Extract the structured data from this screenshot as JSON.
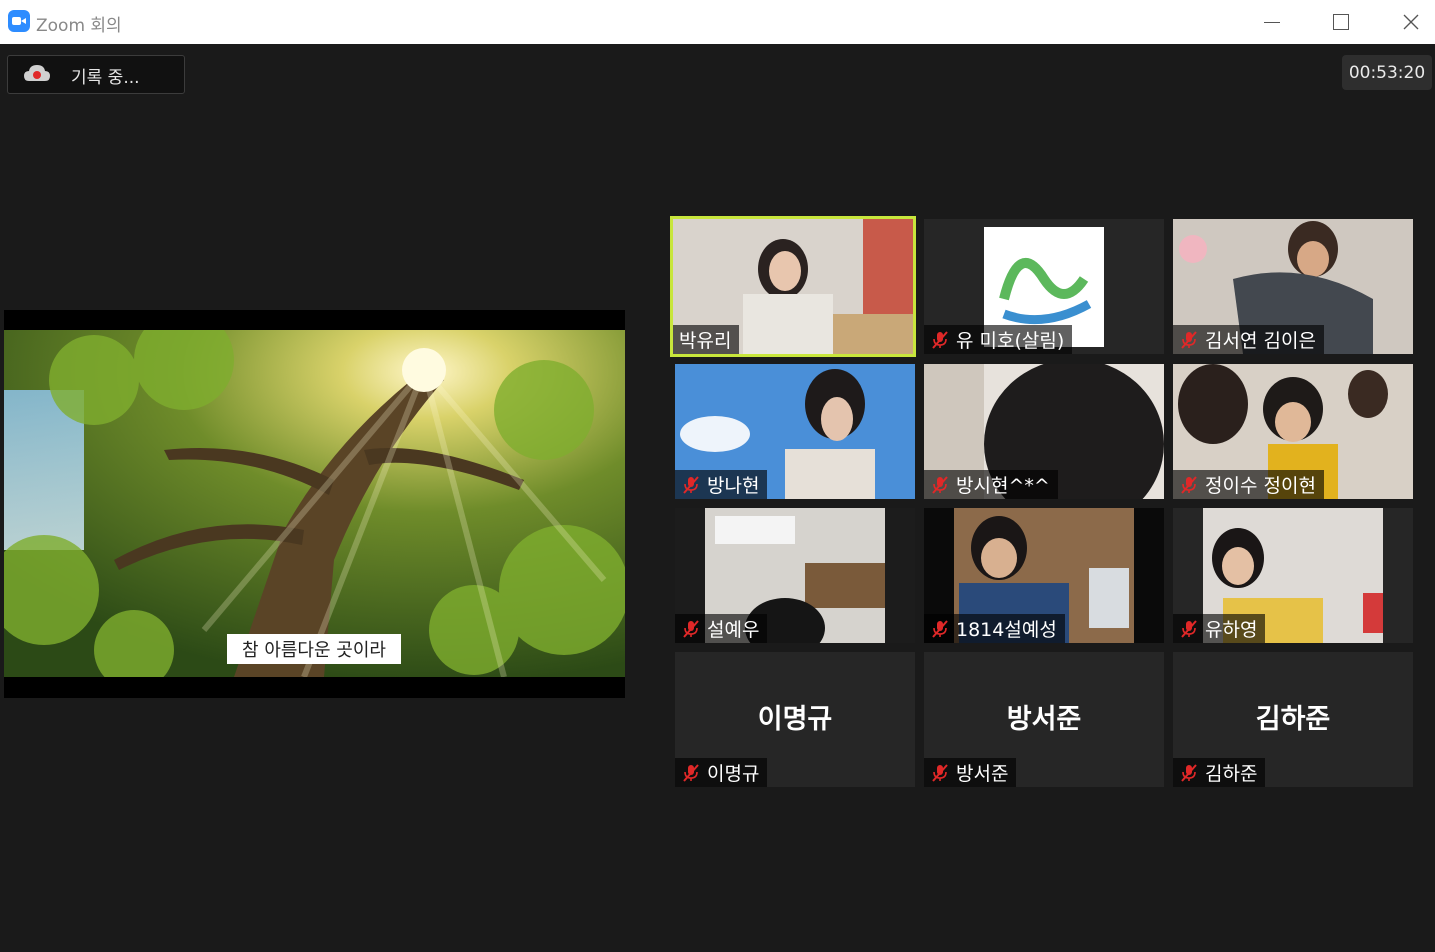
{
  "window": {
    "title": "Zoom 회의",
    "minimize_icon": "minimize-icon",
    "maximize_icon": "maximize-icon",
    "close_icon": "close-icon"
  },
  "recording": {
    "icon": "cloud-record-icon",
    "label": "기록 중..."
  },
  "timer": "00:53:20",
  "share": {
    "caption": "참 아름다운 곳이라",
    "description_icon": "forest-scene"
  },
  "colors": {
    "active_speaker_border": "#c8e63c",
    "background": "#1a1a1a",
    "tile_background": "#262626",
    "zoom_blue": "#2d8cff",
    "mute_red": "#e02828"
  },
  "participants": [
    {
      "name": "박유리",
      "muted": false,
      "video": true,
      "active": true
    },
    {
      "name": "유 미호(살림)",
      "muted": true,
      "video": true,
      "active": false
    },
    {
      "name": "김서연 김이은",
      "muted": true,
      "video": true,
      "active": false
    },
    {
      "name": "방나현",
      "muted": true,
      "video": true,
      "active": false
    },
    {
      "name": "방시현^*^",
      "muted": true,
      "video": true,
      "active": false
    },
    {
      "name": "정이수 정이현",
      "muted": true,
      "video": true,
      "active": false
    },
    {
      "name": "설예우",
      "muted": true,
      "video": true,
      "active": false
    },
    {
      "name": "1814설예성",
      "muted": true,
      "video": true,
      "active": false
    },
    {
      "name": "유하영",
      "muted": true,
      "video": true,
      "active": false
    },
    {
      "name": "이명규",
      "muted": true,
      "video": false,
      "active": false
    },
    {
      "name": "방서준",
      "muted": true,
      "video": false,
      "active": false
    },
    {
      "name": "김하준",
      "muted": true,
      "video": false,
      "active": false
    }
  ]
}
